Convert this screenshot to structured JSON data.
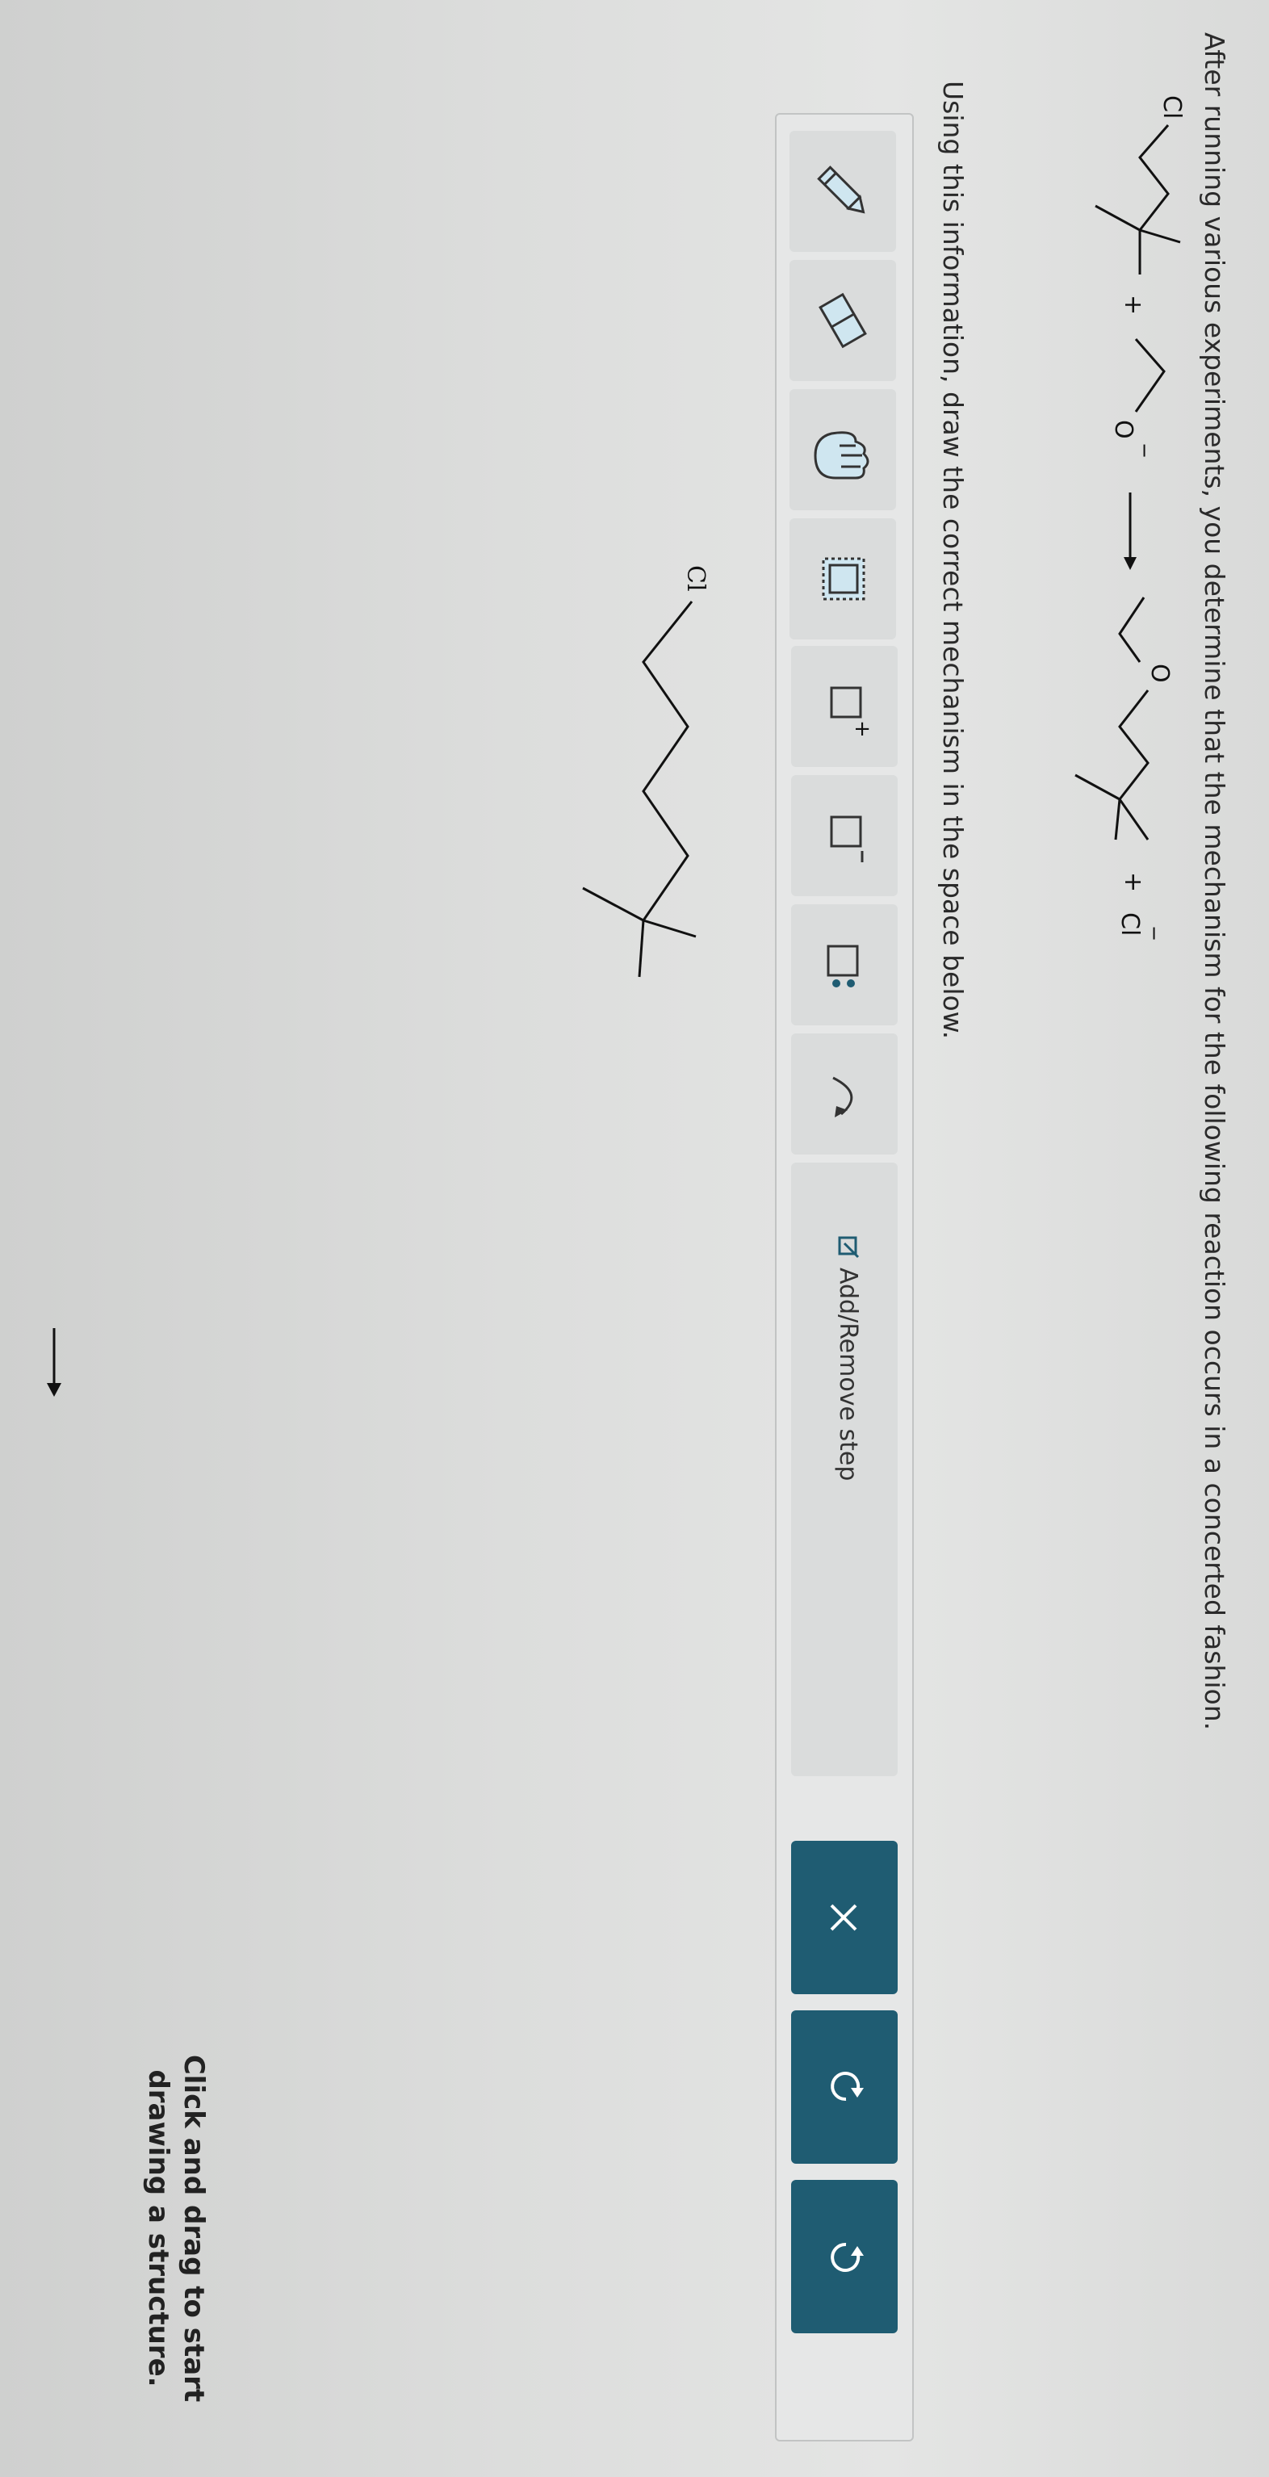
{
  "question": "After running various experiments, you determine that the mechanism for the following reaction occurs in a concerted fashion.",
  "reaction": {
    "reactant1_label": "Cl",
    "plus1": "+",
    "nucleophile_label": "O",
    "nucleophile_charge": "−",
    "product_O_label": "O",
    "plus2": "+",
    "chloride_label": "Cl",
    "chloride_charge": "−"
  },
  "instruction": "Using this information, draw the correct mechanism in the space below.",
  "toolbar": {
    "tools": [
      "pencil-icon",
      "eraser-icon",
      "hand-icon",
      "select-box-icon",
      "add-positive-charge-icon",
      "add-negative-charge-icon",
      "add-lone-pair-icon",
      "curved-arrow-icon"
    ],
    "add_remove_label": "Add/Remove step",
    "actions": [
      "close-icon",
      "undo-icon",
      "redo-icon"
    ],
    "accent_color": "#1f5c72"
  },
  "workspace": {
    "molecule_label": "Cl",
    "hint": "Click and drag to start drawing a structure."
  }
}
